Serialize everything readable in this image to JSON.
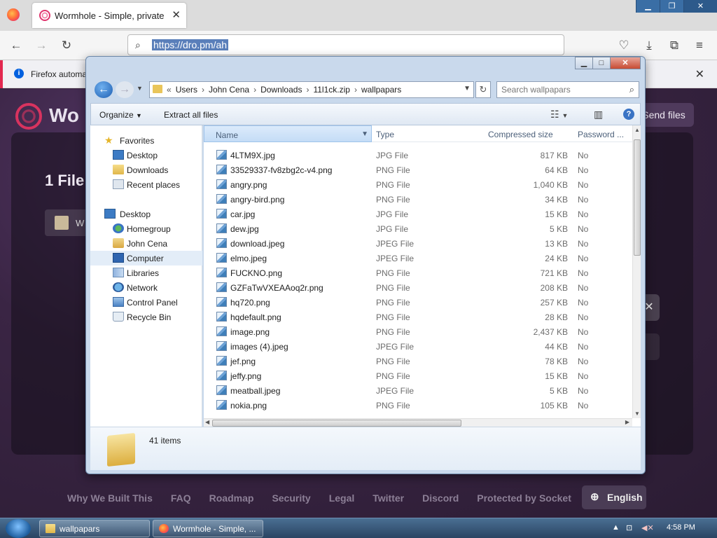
{
  "browser": {
    "tab_title": "Wormhole - Simple, private file sharing",
    "url": "https://dro.pm/ah",
    "notice": "Firefox automation: Browser is being remotely controlled"
  },
  "page": {
    "brand": "Wo",
    "send_button": "Send files",
    "files_heading": "1 File",
    "file_chip_label": "W",
    "footer_links": [
      "Why We Built This",
      "FAQ",
      "Roadmap",
      "Security",
      "Legal",
      "Twitter",
      "Discord",
      "Protected by Socket"
    ],
    "language_button": "English"
  },
  "dialog": {
    "breadcrumb": [
      "Users",
      "John Cena",
      "Downloads",
      "11l1ck.zip",
      "wallpapars"
    ],
    "search_placeholder": "Search wallpapars",
    "toolbar": {
      "organize": "Organize",
      "extract": "Extract all files"
    },
    "nav": {
      "favorites": "Favorites",
      "desktop_fav": "Desktop",
      "downloads": "Downloads",
      "recent": "Recent places",
      "desktop": "Desktop",
      "homegroup": "Homegroup",
      "user": "John Cena",
      "computer": "Computer",
      "libraries": "Libraries",
      "network": "Network",
      "control_panel": "Control Panel",
      "recycle_bin": "Recycle Bin"
    },
    "columns": {
      "name": "Name",
      "type": "Type",
      "size": "Compressed size",
      "password": "Password ..."
    },
    "files": [
      {
        "name": "4LTM9X.jpg",
        "type": "JPG File",
        "size": "817 KB",
        "pw": "No"
      },
      {
        "name": "33529337-fv8zbg2c-v4.png",
        "type": "PNG File",
        "size": "64 KB",
        "pw": "No"
      },
      {
        "name": "angry.png",
        "type": "PNG File",
        "size": "1,040 KB",
        "pw": "No"
      },
      {
        "name": "angry-bird.png",
        "type": "PNG File",
        "size": "34 KB",
        "pw": "No"
      },
      {
        "name": "car.jpg",
        "type": "JPG File",
        "size": "15 KB",
        "pw": "No"
      },
      {
        "name": "dew.jpg",
        "type": "JPG File",
        "size": "5 KB",
        "pw": "No"
      },
      {
        "name": "download.jpeg",
        "type": "JPEG File",
        "size": "13 KB",
        "pw": "No"
      },
      {
        "name": "elmo.jpeg",
        "type": "JPEG File",
        "size": "24 KB",
        "pw": "No"
      },
      {
        "name": "FUCKNO.png",
        "type": "PNG File",
        "size": "721 KB",
        "pw": "No"
      },
      {
        "name": "GZFaTwVXEAAoq2r.png",
        "type": "PNG File",
        "size": "208 KB",
        "pw": "No"
      },
      {
        "name": "hq720.png",
        "type": "PNG File",
        "size": "257 KB",
        "pw": "No"
      },
      {
        "name": "hqdefault.png",
        "type": "PNG File",
        "size": "28 KB",
        "pw": "No"
      },
      {
        "name": "image.png",
        "type": "PNG File",
        "size": "2,437 KB",
        "pw": "No"
      },
      {
        "name": "images (4).jpeg",
        "type": "JPEG File",
        "size": "44 KB",
        "pw": "No"
      },
      {
        "name": "jef.png",
        "type": "PNG File",
        "size": "78 KB",
        "pw": "No"
      },
      {
        "name": "jeffy.png",
        "type": "PNG File",
        "size": "15 KB",
        "pw": "No"
      },
      {
        "name": "meatball.jpeg",
        "type": "JPEG File",
        "size": "5 KB",
        "pw": "No"
      },
      {
        "name": "nokia.png",
        "type": "PNG File",
        "size": "105 KB",
        "pw": "No"
      }
    ],
    "item_count": "41 items"
  },
  "taskbar": {
    "explorer_label": "wallpapars",
    "firefox_label": "Wormhole - Simple, ...",
    "clock": "4:58 PM"
  }
}
